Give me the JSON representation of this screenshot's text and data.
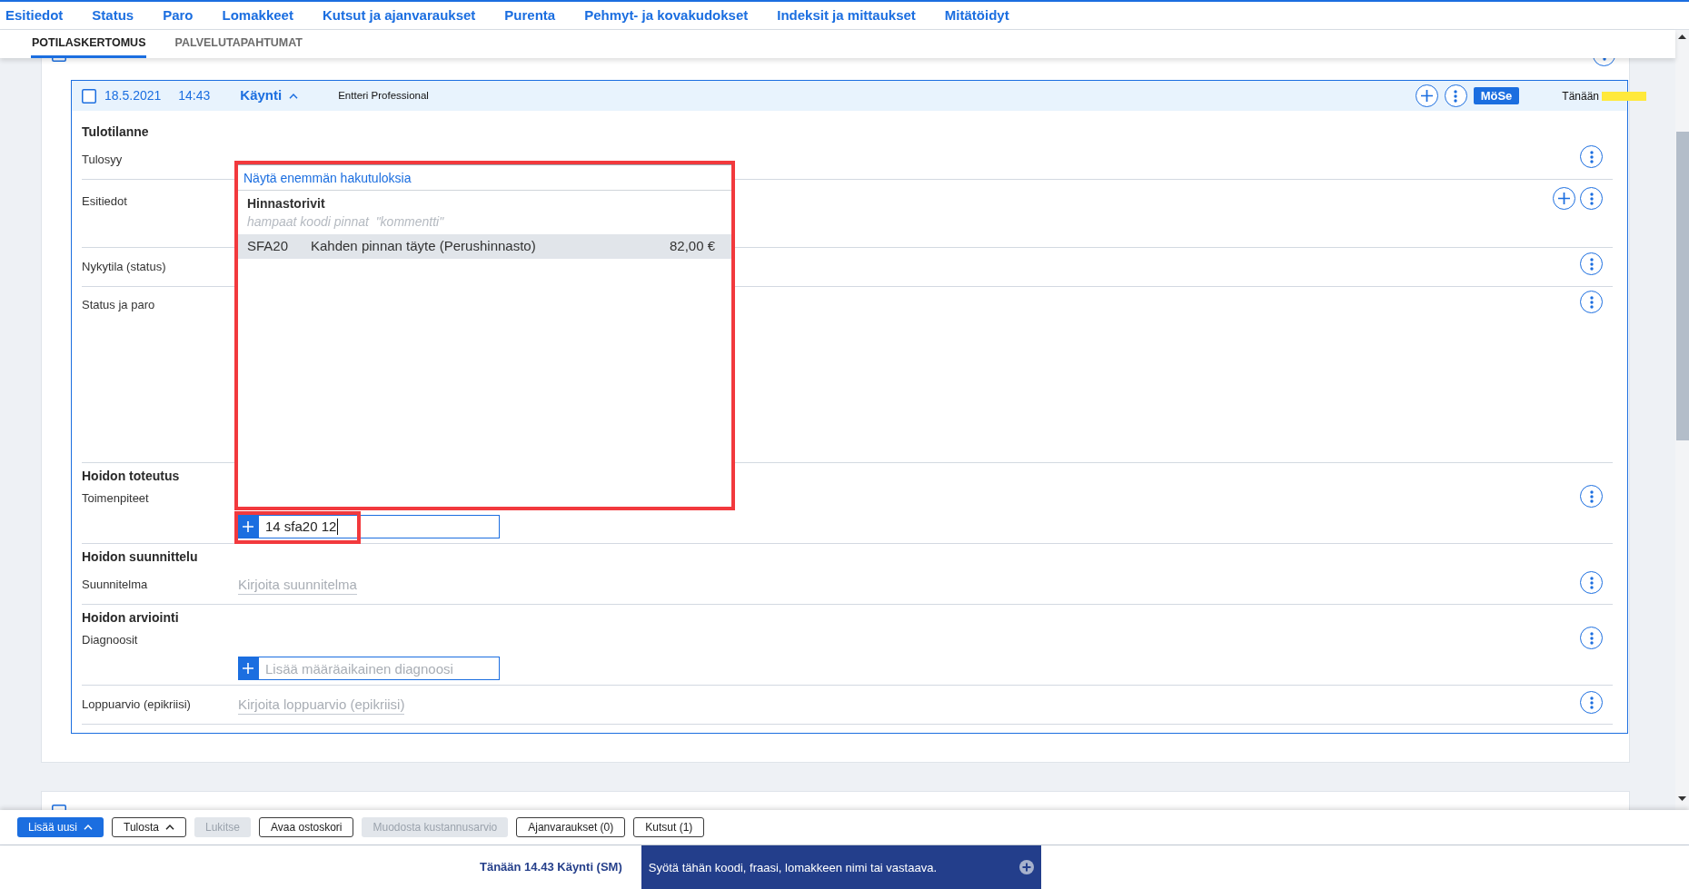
{
  "nav": [
    "Esitiedot",
    "Status",
    "Paro",
    "Lomakkeet",
    "Kutsut ja ajanvaraukset",
    "Purenta",
    "Pehmyt- ja kovakudokset",
    "Indeksit ja mittaukset",
    "Mitätöidyt"
  ],
  "tabs": [
    {
      "label": "POTILASKERTOMUS",
      "selected": true
    },
    {
      "label": "PALVELUTAPAHTUMAT",
      "selected": false
    }
  ],
  "sections": [
    {
      "checked": false,
      "actions": [
        {
          "kind": "menu"
        }
      ],
      "visit": {
        "checked": false,
        "date": "18.5.2021",
        "time": "14:43",
        "type": "Käynti",
        "expanded": true,
        "author": "Entteri Professional",
        "actions": [
          {
            "kind": "add"
          },
          {
            "kind": "menu"
          }
        ],
        "badge": "MöSe",
        "day": "Tänään",
        "groups": [
          {
            "title": "Tulotilanne",
            "fields": [
              {
                "label": "Tulosyy",
                "kind": "empty",
                "actions": [
                  {
                    "kind": "menu"
                  }
                ]
              },
              {
                "label": "Esitiedot",
                "kind": "notes",
                "actions": [
                  {
                    "kind": "add"
                  },
                  {
                    "kind": "menu"
                  }
                ]
              },
              {
                "label": "Nykytila (status)",
                "kind": "empty",
                "actions": [
                  {
                    "kind": "menu"
                  }
                ]
              },
              {
                "label": "Status ja paro",
                "kind": "area",
                "actions": [
                  {
                    "kind": "menu"
                  }
                ]
              }
            ]
          },
          {
            "title": "Hoidon toteutus",
            "fields": [
              {
                "label": "Toimenpiteet",
                "kind": "code_input",
                "value": "14 sfa20 12",
                "highlighted": true,
                "actions": [
                  {
                    "kind": "menu"
                  }
                ],
                "suggestions": {
                  "highlighted": true,
                  "more_link": "Näytä enemmän hakutuloksia",
                  "group": "Hinnastorivit",
                  "hint": "hampaat koodi pinnat  \"kommentti\"",
                  "rows": [
                    {
                      "code": "SFA20",
                      "name": "Kahden pinnan täyte (Perushinnasto)",
                      "price": "82,00 €",
                      "selected": true
                    }
                  ]
                }
              }
            ]
          },
          {
            "title": "Hoidon suunnittelu",
            "fields": [
              {
                "label": "Suunnitelma",
                "kind": "text",
                "placeholder": "Kirjoita suunnitelma",
                "actions": [
                  {
                    "kind": "menu"
                  }
                ]
              }
            ]
          },
          {
            "title": "Hoidon arviointi",
            "fields": [
              {
                "label": "Diagnoosit",
                "kind": "code_input",
                "placeholder": "Lisää määräaikainen diagnoosi",
                "actions": [
                  {
                    "kind": "menu"
                  }
                ]
              },
              {
                "label": "Loppuarvio (epikriisi)",
                "kind": "text",
                "placeholder": "Kirjoita loppuarvio (epikriisi)",
                "actions": [
                  {
                    "kind": "menu"
                  }
                ]
              }
            ]
          }
        ]
      }
    },
    {
      "checked": false
    }
  ],
  "toolbar": [
    {
      "label": "Lisää uusi",
      "kind": "primary",
      "disabled": false,
      "caret": true
    },
    {
      "label": "Tulosta",
      "kind": "secondary",
      "disabled": false,
      "caret": true
    },
    {
      "label": "Lukitse",
      "kind": "secondary",
      "disabled": true,
      "caret": false
    },
    {
      "label": "Avaa ostoskori",
      "kind": "secondary",
      "disabled": false,
      "caret": false
    },
    {
      "label": "Muodosta kustannusarvio",
      "kind": "secondary",
      "disabled": true,
      "caret": false
    },
    {
      "label": "Ajanvaraukset (0)",
      "kind": "secondary",
      "disabled": false,
      "caret": false
    },
    {
      "label": "Kutsut (1)",
      "kind": "secondary",
      "disabled": false,
      "caret": false
    }
  ],
  "status_bar": {
    "current": "Tänään 14.43 Käynti (SM)",
    "command_placeholder": "Syötä tähän koodi, fraasi, lomakkeen nimi tai vastaava."
  }
}
